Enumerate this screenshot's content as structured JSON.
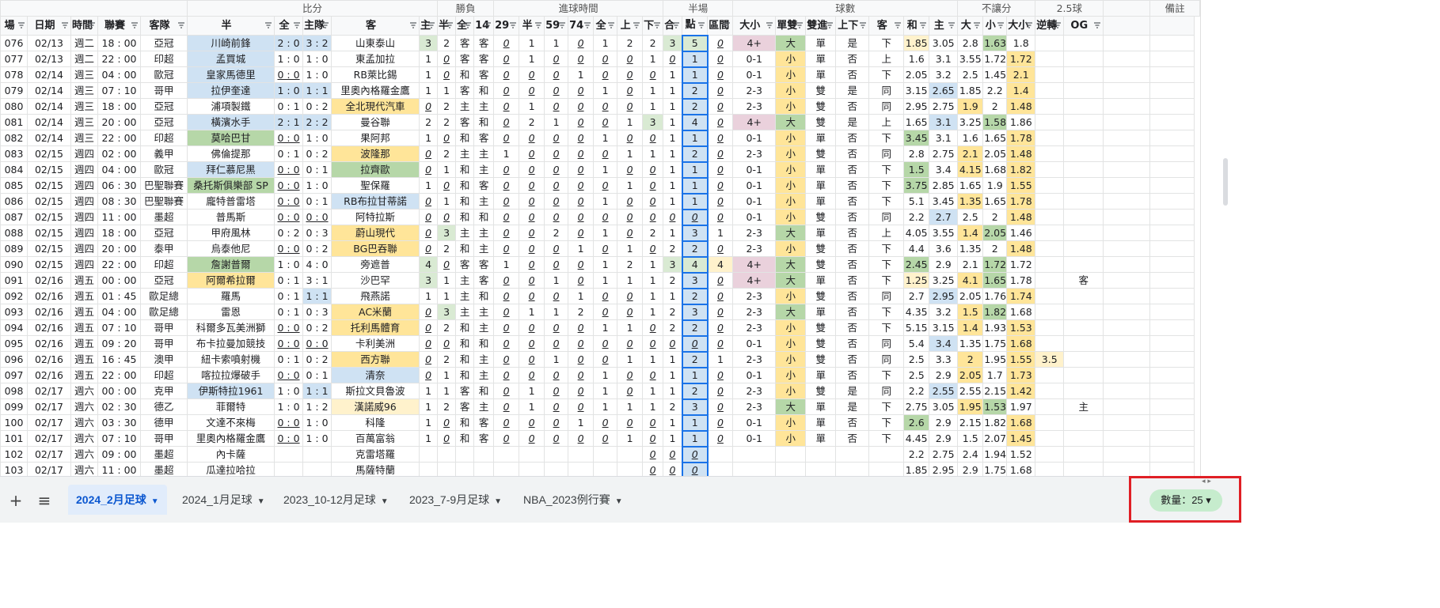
{
  "header": {
    "groups": [
      {
        "label": "",
        "span": 5
      },
      {
        "label": "比分",
        "span": 5
      },
      {
        "label": "勝負",
        "span": 3
      },
      {
        "label": "進球時間",
        "span": 7
      },
      {
        "label": "半場",
        "span": 3
      },
      {
        "label": "球數",
        "span": 7
      },
      {
        "label": "不讓分",
        "span": 3
      },
      {
        "label": "2.5球",
        "span": 2
      },
      {
        "label": "",
        "span": 1
      },
      {
        "label": "備註",
        "span": 2
      }
    ],
    "columns": [
      "場",
      "日期",
      "時間",
      "聯賽",
      "客隊",
      "半",
      "全",
      "主隊",
      "客",
      "主",
      "半",
      "全",
      "14",
      "29",
      "半",
      "59",
      "74",
      "全",
      "上",
      "下",
      "合",
      "點",
      "區間",
      "大小",
      "單雙",
      "雙進",
      "上下",
      "客",
      "和",
      "主",
      "大",
      "小",
      "大小",
      "逆轉",
      "OG"
    ]
  },
  "rows": [
    [
      "076",
      "02/13",
      "週二",
      "18 : 00",
      "亞冠",
      "川崎前鋒",
      "2 : 0",
      "3 : 2",
      "山東泰山",
      "3",
      "2",
      "客",
      "客",
      "0",
      "1",
      "1",
      "0",
      "1",
      "2",
      "2",
      "3",
      "5",
      "0",
      "4+",
      "大",
      "單",
      "是",
      "下",
      "1.85",
      "3.05",
      "2.8",
      "1.63",
      "1.8",
      "",
      "",
      ""
    ],
    [
      "077",
      "02/13",
      "週二",
      "22 : 00",
      "印超",
      "孟買城",
      "1 : 0",
      "1 : 0",
      "東孟加拉",
      "1",
      "0",
      "客",
      "客",
      "0",
      "1",
      "0",
      "0",
      "0",
      "0",
      "1",
      "0",
      "1",
      "0",
      "0-1",
      "小",
      "單",
      "否",
      "上",
      "1.6",
      "3.1",
      "3.55",
      "1.72",
      "1.72",
      "",
      "",
      ""
    ],
    [
      "078",
      "02/14",
      "週三",
      "04 : 00",
      "歐冠",
      "皇家馬德里",
      "0 : 0",
      "1 : 0",
      "RB萊比錫",
      "1",
      "0",
      "和",
      "客",
      "0",
      "0",
      "0",
      "1",
      "0",
      "0",
      "0",
      "1",
      "1",
      "0",
      "0-1",
      "小",
      "單",
      "否",
      "下",
      "2.05",
      "3.2",
      "2.5",
      "1.45",
      "2.1",
      "",
      "",
      ""
    ],
    [
      "079",
      "02/14",
      "週三",
      "07 : 10",
      "哥甲",
      "拉伊奎達",
      "1 : 0",
      "1 : 1",
      "里奧內格羅金鷹",
      "1",
      "1",
      "客",
      "和",
      "0",
      "0",
      "0",
      "0",
      "1",
      "0",
      "1",
      "1",
      "2",
      "0",
      "2-3",
      "小",
      "雙",
      "是",
      "同",
      "3.15",
      "2.65",
      "1.85",
      "2.2",
      "1.4",
      "",
      "",
      ""
    ],
    [
      "080",
      "02/14",
      "週三",
      "18 : 00",
      "亞冠",
      "浦項製鐵",
      "0 : 1",
      "0 : 2",
      "全北現代汽車",
      "0",
      "2",
      "主",
      "主",
      "0",
      "1",
      "0",
      "0",
      "0",
      "0",
      "1",
      "1",
      "2",
      "0",
      "2-3",
      "小",
      "雙",
      "否",
      "同",
      "2.95",
      "2.75",
      "1.9",
      "2",
      "1.48",
      "",
      "",
      ""
    ],
    [
      "081",
      "02/14",
      "週三",
      "20 : 00",
      "亞冠",
      "橫濱水手",
      "2 : 1",
      "2 : 2",
      "曼谷聯",
      "2",
      "2",
      "客",
      "和",
      "0",
      "2",
      "1",
      "0",
      "0",
      "1",
      "3",
      "1",
      "4",
      "0",
      "4+",
      "大",
      "雙",
      "是",
      "上",
      "1.65",
      "3.1",
      "3.25",
      "1.58",
      "1.86",
      "",
      "",
      ""
    ],
    [
      "082",
      "02/14",
      "週三",
      "22 : 00",
      "印超",
      "莫哈巴甘",
      "0 : 0",
      "1 : 0",
      "果阿邦",
      "1",
      "0",
      "和",
      "客",
      "0",
      "0",
      "0",
      "0",
      "1",
      "0",
      "0",
      "1",
      "1",
      "0",
      "0-1",
      "小",
      "單",
      "否",
      "下",
      "3.45",
      "3.1",
      "1.6",
      "1.65",
      "1.78",
      "",
      "",
      ""
    ],
    [
      "083",
      "02/15",
      "週四",
      "02 : 00",
      "義甲",
      "佛倫提那",
      "0 : 1",
      "0 : 2",
      "波隆那",
      "0",
      "2",
      "主",
      "主",
      "1",
      "0",
      "0",
      "0",
      "0",
      "1",
      "1",
      "1",
      "2",
      "0",
      "2-3",
      "小",
      "雙",
      "否",
      "同",
      "2.8",
      "2.75",
      "2.1",
      "2.05",
      "1.48",
      "",
      "",
      ""
    ],
    [
      "084",
      "02/15",
      "週四",
      "04 : 00",
      "歐冠",
      "拜仁慕尼黑",
      "0 : 0",
      "0 : 1",
      "拉齊歐",
      "0",
      "1",
      "和",
      "主",
      "0",
      "0",
      "0",
      "0",
      "1",
      "0",
      "0",
      "1",
      "1",
      "0",
      "0-1",
      "小",
      "單",
      "否",
      "下",
      "1.5",
      "3.4",
      "4.15",
      "1.68",
      "1.82",
      "",
      "",
      ""
    ],
    [
      "085",
      "02/15",
      "週四",
      "06 : 30",
      "巴聖聯賽",
      "桑托斯俱樂部 SP",
      "0 : 0",
      "1 : 0",
      "聖保羅",
      "1",
      "0",
      "和",
      "客",
      "0",
      "0",
      "0",
      "0",
      "0",
      "1",
      "0",
      "1",
      "1",
      "0",
      "0-1",
      "小",
      "單",
      "否",
      "下",
      "3.75",
      "2.85",
      "1.65",
      "1.9",
      "1.55",
      "",
      "",
      ""
    ],
    [
      "086",
      "02/15",
      "週四",
      "08 : 30",
      "巴聖聯賽",
      "龐特普雷塔",
      "0 : 0",
      "0 : 1",
      "RB布拉甘蒂諾",
      "0",
      "1",
      "和",
      "主",
      "0",
      "0",
      "0",
      "0",
      "1",
      "0",
      "0",
      "1",
      "1",
      "0",
      "0-1",
      "小",
      "單",
      "否",
      "下",
      "5.1",
      "3.45",
      "1.35",
      "1.65",
      "1.78",
      "",
      "",
      ""
    ],
    [
      "087",
      "02/15",
      "週四",
      "11 : 00",
      "墨超",
      "普馬斯",
      "0 : 0",
      "0 : 0",
      "阿特拉斯",
      "0",
      "0",
      "和",
      "和",
      "0",
      "0",
      "0",
      "0",
      "0",
      "0",
      "0",
      "0",
      "0",
      "0",
      "0-1",
      "小",
      "雙",
      "否",
      "同",
      "2.2",
      "2.7",
      "2.5",
      "2",
      "1.48",
      "",
      "",
      ""
    ],
    [
      "088",
      "02/15",
      "週四",
      "18 : 00",
      "亞冠",
      "甲府風林",
      "0 : 2",
      "0 : 3",
      "蔚山現代",
      "0",
      "3",
      "主",
      "主",
      "0",
      "0",
      "2",
      "0",
      "1",
      "0",
      "2",
      "1",
      "3",
      "1",
      "2-3",
      "大",
      "單",
      "否",
      "上",
      "4.05",
      "3.55",
      "1.4",
      "2.05",
      "1.46",
      "",
      "",
      ""
    ],
    [
      "089",
      "02/15",
      "週四",
      "20 : 00",
      "泰甲",
      "烏泰他尼",
      "0 : 0",
      "0 : 2",
      "BG巴吞聯",
      "0",
      "2",
      "和",
      "主",
      "0",
      "0",
      "0",
      "1",
      "0",
      "1",
      "0",
      "2",
      "2",
      "0",
      "2-3",
      "小",
      "雙",
      "否",
      "下",
      "4.4",
      "3.6",
      "1.35",
      "2",
      "1.48",
      "",
      "",
      ""
    ],
    [
      "090",
      "02/15",
      "週四",
      "22 : 00",
      "印超",
      "詹謝普爾",
      "1 : 0",
      "4 : 0",
      "旁遮普",
      "4",
      "0",
      "客",
      "客",
      "1",
      "0",
      "0",
      "0",
      "1",
      "2",
      "1",
      "3",
      "4",
      "4",
      "4+",
      "大",
      "雙",
      "否",
      "下",
      "2.45",
      "2.9",
      "2.1",
      "1.72",
      "1.72",
      "",
      "",
      ""
    ],
    [
      "091",
      "02/16",
      "週五",
      "00 : 00",
      "亞冠",
      "阿爾希拉爾",
      "0 : 1",
      "3 : 1",
      "沙巴罕",
      "3",
      "1",
      "主",
      "客",
      "0",
      "0",
      "1",
      "0",
      "1",
      "1",
      "1",
      "2",
      "3",
      "0",
      "4+",
      "大",
      "單",
      "否",
      "下",
      "1.25",
      "3.25",
      "4.1",
      "1.65",
      "1.78",
      "",
      "客",
      ""
    ],
    [
      "092",
      "02/16",
      "週五",
      "01 : 45",
      "歐足總",
      "羅馬",
      "0 : 1",
      "1 : 1",
      "飛燕諾",
      "1",
      "1",
      "主",
      "和",
      "0",
      "0",
      "0",
      "1",
      "0",
      "0",
      "1",
      "1",
      "2",
      "0",
      "2-3",
      "小",
      "雙",
      "否",
      "同",
      "2.7",
      "2.95",
      "2.05",
      "1.76",
      "1.74",
      "",
      "",
      ""
    ],
    [
      "093",
      "02/16",
      "週五",
      "04 : 00",
      "歐足總",
      "雷恩",
      "0 : 1",
      "0 : 3",
      "AC米蘭",
      "0",
      "3",
      "主",
      "主",
      "0",
      "1",
      "1",
      "2",
      "0",
      "0",
      "1",
      "2",
      "3",
      "0",
      "2-3",
      "大",
      "單",
      "否",
      "下",
      "4.35",
      "3.2",
      "1.5",
      "1.82",
      "1.68",
      "",
      "",
      ""
    ],
    [
      "094",
      "02/16",
      "週五",
      "07 : 10",
      "哥甲",
      "科爾多瓦美洲獅",
      "0 : 0",
      "0 : 2",
      "托利馬體育",
      "0",
      "2",
      "和",
      "主",
      "0",
      "0",
      "0",
      "0",
      "1",
      "1",
      "0",
      "2",
      "2",
      "0",
      "2-3",
      "小",
      "雙",
      "否",
      "下",
      "5.15",
      "3.15",
      "1.4",
      "1.93",
      "1.53",
      "",
      "",
      ""
    ],
    [
      "095",
      "02/16",
      "週五",
      "09 : 20",
      "哥甲",
      "布卡拉曼加競技",
      "0 : 0",
      "0 : 0",
      "卡利美洲",
      "0",
      "0",
      "和",
      "和",
      "0",
      "0",
      "0",
      "0",
      "0",
      "0",
      "0",
      "0",
      "0",
      "0",
      "0-1",
      "小",
      "雙",
      "否",
      "同",
      "5.4",
      "3.4",
      "1.35",
      "1.75",
      "1.68",
      "",
      "",
      ""
    ],
    [
      "096",
      "02/16",
      "週五",
      "16 : 45",
      "澳甲",
      "紐卡索噴射機",
      "0 : 1",
      "0 : 2",
      "西方聯",
      "0",
      "2",
      "和",
      "主",
      "0",
      "0",
      "1",
      "0",
      "0",
      "1",
      "1",
      "1",
      "2",
      "1",
      "2-3",
      "小",
      "雙",
      "否",
      "同",
      "2.5",
      "3.3",
      "2",
      "1.95",
      "1.55",
      "3.5",
      "",
      ""
    ],
    [
      "097",
      "02/16",
      "週五",
      "22 : 00",
      "印超",
      "喀拉拉爆破手",
      "0 : 0",
      "0 : 1",
      "清奈",
      "0",
      "1",
      "和",
      "主",
      "0",
      "0",
      "0",
      "0",
      "1",
      "0",
      "0",
      "1",
      "1",
      "0",
      "0-1",
      "小",
      "單",
      "否",
      "下",
      "2.5",
      "2.9",
      "2.05",
      "1.7",
      "1.73",
      "",
      "",
      ""
    ],
    [
      "098",
      "02/17",
      "週六",
      "00 : 00",
      "克甲",
      "伊斯特拉1961",
      "1 : 0",
      "1 : 1",
      "斯拉文貝魯波",
      "1",
      "1",
      "客",
      "和",
      "0",
      "1",
      "0",
      "0",
      "1",
      "0",
      "1",
      "1",
      "2",
      "0",
      "2-3",
      "小",
      "雙",
      "是",
      "同",
      "2.2",
      "2.55",
      "2.55",
      "2.15",
      "1.42",
      "",
      "",
      ""
    ],
    [
      "099",
      "02/17",
      "週六",
      "02 : 30",
      "德乙",
      "菲爾特",
      "1 : 0",
      "1 : 2",
      "漢諾威96",
      "1",
      "2",
      "客",
      "主",
      "0",
      "1",
      "0",
      "0",
      "1",
      "1",
      "1",
      "2",
      "3",
      "0",
      "2-3",
      "大",
      "單",
      "是",
      "下",
      "2.75",
      "3.05",
      "1.95",
      "1.53",
      "1.97",
      "",
      "主",
      ""
    ],
    [
      "100",
      "02/17",
      "週六",
      "03 : 30",
      "德甲",
      "文達不來梅",
      "0 : 0",
      "1 : 0",
      "科隆",
      "1",
      "0",
      "和",
      "客",
      "0",
      "0",
      "0",
      "1",
      "0",
      "0",
      "0",
      "1",
      "1",
      "0",
      "0-1",
      "小",
      "單",
      "否",
      "下",
      "2.6",
      "2.9",
      "2.15",
      "1.82",
      "1.68",
      "",
      "",
      ""
    ],
    [
      "101",
      "02/17",
      "週六",
      "07 : 10",
      "哥甲",
      "里奧內格羅金鷹",
      "0 : 0",
      "1 : 0",
      "百萬富翁",
      "1",
      "0",
      "和",
      "客",
      "0",
      "0",
      "0",
      "0",
      "0",
      "1",
      "0",
      "1",
      "1",
      "0",
      "0-1",
      "小",
      "單",
      "否",
      "下",
      "4.45",
      "2.9",
      "1.5",
      "2.07",
      "1.45",
      "",
      "",
      ""
    ],
    [
      "102",
      "02/17",
      "週六",
      "09 : 00",
      "墨超",
      "內卡薩",
      "",
      "",
      "克雷塔羅",
      "",
      "",
      "",
      "",
      "",
      "",
      "",
      "",
      "",
      "",
      "0",
      "0",
      "0",
      "",
      "",
      "",
      "",
      "",
      "",
      "2.2",
      "2.75",
      "2.4",
      "1.94",
      "1.52",
      "",
      "",
      ""
    ],
    [
      "103",
      "02/17",
      "週六",
      "11 : 00",
      "墨超",
      "瓜達拉哈拉",
      "",
      "",
      "馬薩特蘭",
      "",
      "",
      "",
      "",
      "",
      "",
      "",
      "",
      "",
      "",
      "0",
      "0",
      "0",
      "",
      "",
      "",
      "",
      "",
      "",
      "1.85",
      "2.95",
      "2.9",
      "1.75",
      "1.68",
      "",
      "",
      ""
    ]
  ],
  "sheet_tabs": [
    "2024_2月足球",
    "2024_1月足球",
    "2023_10-12月足球",
    "2023_7-9月足球",
    "NBA_2023例行賽"
  ],
  "active_tab_index": 0,
  "status": {
    "count_label": "數量：25"
  },
  "colors": {
    "highlight_blue": "#cfe2f3",
    "highlight_green": "#b6d7a8",
    "highlight_yellow": "#ffe599",
    "highlight_pink": "#ead1dc",
    "selection": "#1a73e8",
    "count_chip": "#c6eccd",
    "callout_box": "#e01f25"
  }
}
